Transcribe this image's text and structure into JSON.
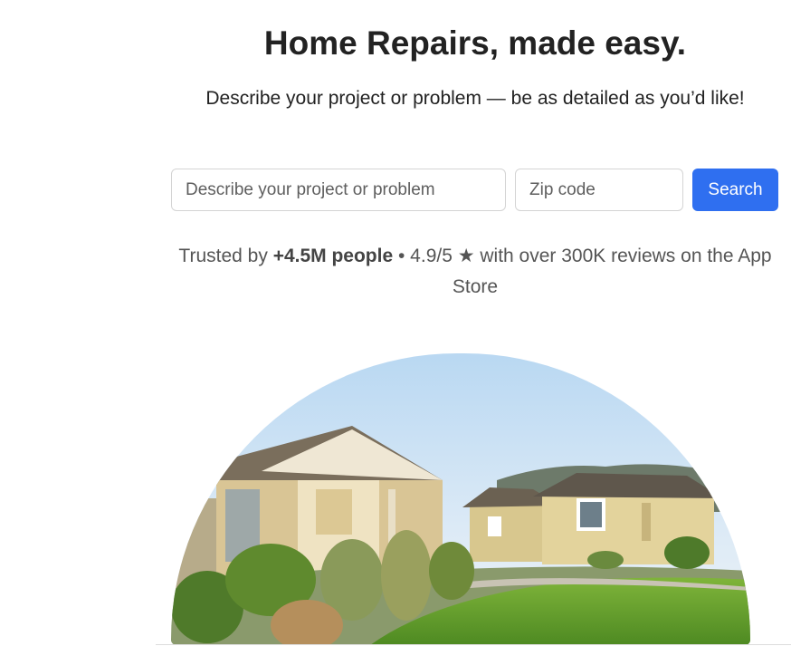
{
  "hero": {
    "title": "Home Repairs, made easy.",
    "subtitle": "Describe your project or problem — be as detailed as you’d like!"
  },
  "search": {
    "project_placeholder": "Describe your project or problem",
    "zip_placeholder": "Zip code",
    "button_label": "Search"
  },
  "trust": {
    "prefix": "Trusted by ",
    "people": "+4.5M people",
    "suffix": " • 4.9/5 ★ with over 300K reviews on the App Store"
  },
  "colors": {
    "accent": "#2f6ff0",
    "heading": "#222222",
    "muted_text": "#555555"
  }
}
